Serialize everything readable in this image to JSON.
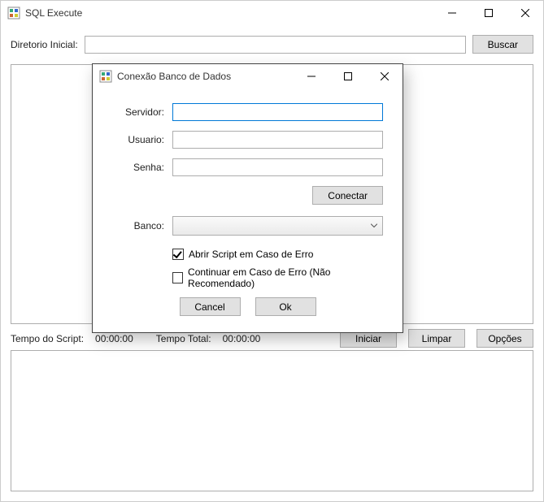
{
  "main": {
    "title": "SQL Execute",
    "diretorio_label": "Diretorio Inicial:",
    "diretorio_value": "",
    "buscar": "Buscar",
    "tempo_script_label": "Tempo do Script:",
    "tempo_script_value": "00:00:00",
    "tempo_total_label": "Tempo Total:",
    "tempo_total_value": "00:00:00",
    "iniciar": "Iniciar",
    "limpar": "Limpar",
    "opcoes": "Opções"
  },
  "dialog": {
    "title": "Conexão Banco de Dados",
    "servidor_label": "Servidor:",
    "usuario_label": "Usuario:",
    "senha_label": "Senha:",
    "banco_label": "Banco:",
    "servidor_value": "",
    "usuario_value": "",
    "senha_value": "",
    "banco_value": "",
    "conectar": "Conectar",
    "chk_abrir": "Abrir Script em Caso de Erro",
    "chk_continuar": "Continuar em Caso de Erro (Não Recomendado)",
    "chk_abrir_checked": true,
    "chk_continuar_checked": false,
    "cancel": "Cancel",
    "ok": "Ok"
  }
}
